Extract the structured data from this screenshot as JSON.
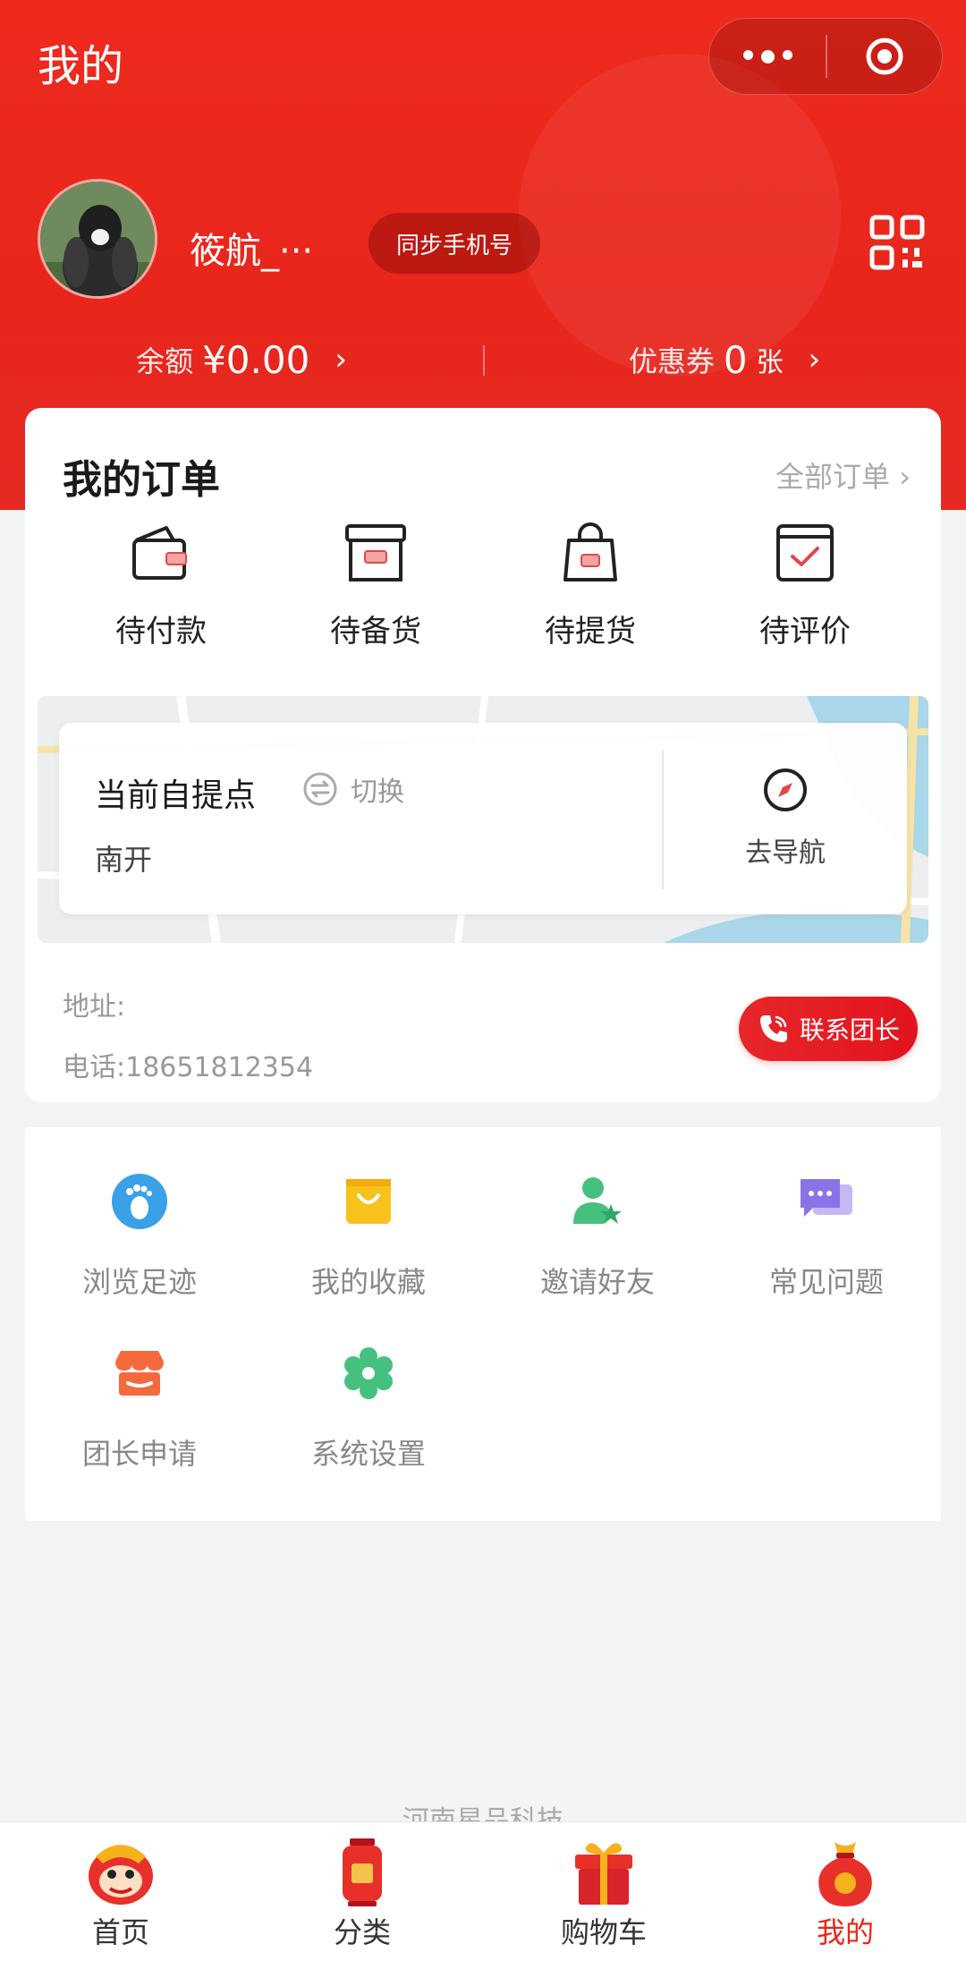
{
  "header": {
    "title": "我的",
    "accent_color": "#e8261c"
  },
  "user": {
    "nickname": "筱航_···",
    "sync_button": "同步手机号"
  },
  "stats": {
    "balance_label": "余额",
    "balance_value": "¥0.00",
    "coupon_label": "优惠券",
    "coupon_count": "0",
    "coupon_unit": "张"
  },
  "orders": {
    "title": "我的订单",
    "all_link": "全部订单",
    "items": [
      {
        "label": "待付款",
        "icon": "wallet-icon"
      },
      {
        "label": "待备货",
        "icon": "box-icon"
      },
      {
        "label": "待提货",
        "icon": "bag-icon"
      },
      {
        "label": "待评价",
        "icon": "review-icon"
      }
    ]
  },
  "pickup": {
    "title": "当前自提点",
    "switch_label": "切换",
    "name": "南开",
    "nav_label": "去导航",
    "address": "地址:",
    "phone": "电话:18651812354",
    "contact_button": "联系团长"
  },
  "tools": [
    {
      "label": "浏览足迹",
      "icon": "footprint-icon"
    },
    {
      "label": "我的收藏",
      "icon": "favorites-bag-icon"
    },
    {
      "label": "邀请好友",
      "icon": "invite-friend-icon"
    },
    {
      "label": "常见问题",
      "icon": "faq-chat-icon"
    },
    {
      "label": "团长申请",
      "icon": "shop-apply-icon"
    },
    {
      "label": "系统设置",
      "icon": "settings-gear-icon"
    }
  ],
  "footer": {
    "company": "河南星品科技"
  },
  "tabbar": [
    {
      "label": "首页",
      "icon": "lion-home-icon",
      "active": false
    },
    {
      "label": "分类",
      "icon": "lantern-category-icon",
      "active": false
    },
    {
      "label": "购物车",
      "icon": "gift-cart-icon",
      "active": false
    },
    {
      "label": "我的",
      "icon": "lucky-bag-profile-icon",
      "active": true
    }
  ]
}
